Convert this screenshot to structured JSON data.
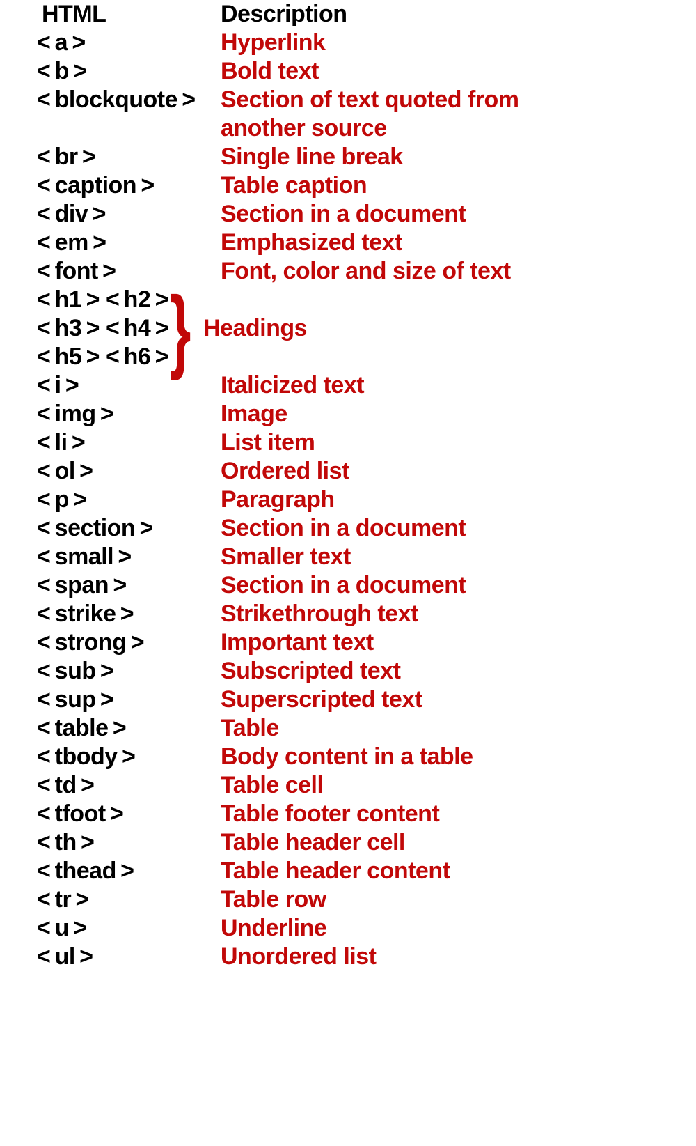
{
  "headers": {
    "col1": "HTML",
    "col2": "Description"
  },
  "rows": [
    {
      "tag": "a",
      "desc": "Hyperlink"
    },
    {
      "tag": "b",
      "desc": "Bold text"
    },
    {
      "tag": "blockquote",
      "desc": "Section of text quoted from another source",
      "wrap": true,
      "span": 2
    },
    {
      "tag": "br",
      "desc": "Single line break"
    },
    {
      "tag": "caption",
      "desc": "Table caption"
    },
    {
      "tag": "div",
      "desc": "Section in a document"
    },
    {
      "tag": "em",
      "desc": "Emphasized text"
    },
    {
      "tag": "font",
      "desc": "Font, color and size of text"
    },
    {
      "tags": [
        "h1",
        "h2",
        "h3",
        "h4",
        "h5",
        "h6"
      ],
      "desc": "Headings",
      "group": true,
      "span": 3
    },
    {
      "tag": "i",
      "desc": "Italicized text"
    },
    {
      "tag": "img",
      "desc": "Image"
    },
    {
      "tag": "li",
      "desc": "List item"
    },
    {
      "tag": "ol",
      "desc": "Ordered list"
    },
    {
      "tag": "p",
      "desc": "Paragraph"
    },
    {
      "tag": "section",
      "desc": "Section in a document"
    },
    {
      "tag": "small",
      "desc": "Smaller text"
    },
    {
      "tag": "span",
      "desc": "Section in a document"
    },
    {
      "tag": "strike",
      "desc": "Strikethrough text"
    },
    {
      "tag": "strong",
      "desc": "Important text"
    },
    {
      "tag": "sub",
      "desc": "Subscripted text"
    },
    {
      "tag": "sup",
      "desc": "Superscripted text"
    },
    {
      "tag": "table",
      "desc": "Table"
    },
    {
      "tag": "tbody",
      "desc": "Body content in a table"
    },
    {
      "tag": "td",
      "desc": "Table cell"
    },
    {
      "tag": "tfoot",
      "desc": "Table footer content"
    },
    {
      "tag": "th",
      "desc": "Table header cell"
    },
    {
      "tag": "thead",
      "desc": "Table header content"
    },
    {
      "tag": "tr",
      "desc": "Table row"
    },
    {
      "tag": "u",
      "desc": "Underline"
    },
    {
      "tag": "ul",
      "desc": "Unordered list"
    }
  ],
  "glyphs": {
    "lt": "<",
    "gt": ">",
    "brace": "}",
    "nbsp": " ",
    "thinsp": " "
  }
}
